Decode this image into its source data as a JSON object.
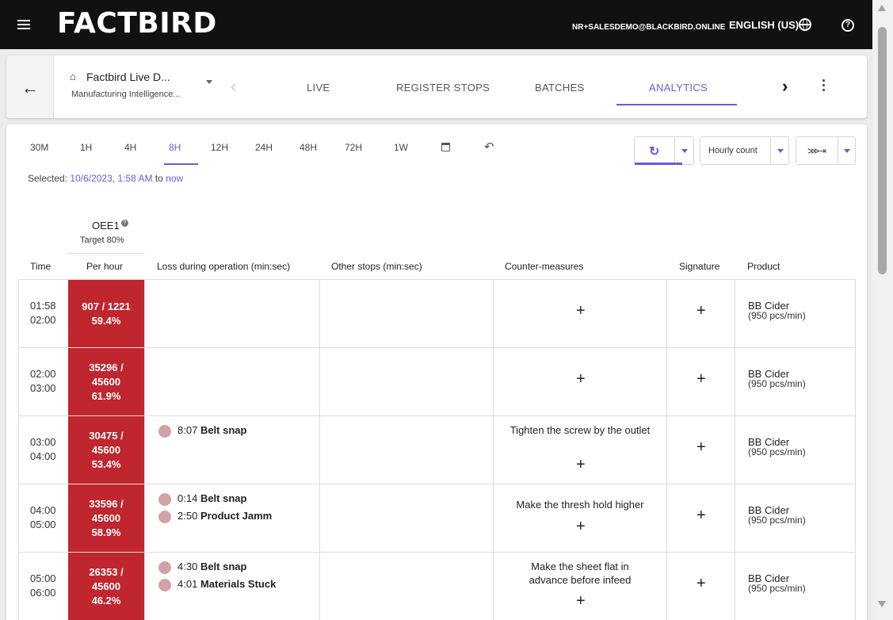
{
  "header": {
    "logo": "FACTBIRD",
    "email": "NR+SALESDEMO@BLACKBIRD.ONLINE",
    "language": "ENGLISH (US)",
    "help_icon": "?"
  },
  "device": {
    "name": "Factbird Live D...",
    "subtitle": "Manufacturing Intelligence..."
  },
  "tabs": [
    {
      "label": "LIVE"
    },
    {
      "label": "REGISTER STOPS"
    },
    {
      "label": "BATCHES"
    },
    {
      "label": "ANALYTICS"
    }
  ],
  "ranges": [
    "30M",
    "1H",
    "4H",
    "8H",
    "12H",
    "24H",
    "48H",
    "72H",
    "1W"
  ],
  "selected": {
    "prefix": "Selected:",
    "from": "10/6/2023, 1:58 AM",
    "to_word": "to",
    "to": "now"
  },
  "controls": {
    "count_label": "Hourly count",
    "layout_icon": "⋙⇥"
  },
  "table": {
    "oee_title": "OEE1",
    "oee_target": "Target 80%",
    "headers": {
      "time": "Time",
      "per_hour": "Per hour",
      "loss": "Loss during operation (min:sec)",
      "other": "Other stops (min:sec)",
      "counter": "Counter-measures",
      "signature": "Signature",
      "product": "Product"
    },
    "rows": [
      {
        "start": "01:58",
        "end": "02:00",
        "count": "907 / 1221",
        "pct": "59.4%",
        "losses": [],
        "counter": "",
        "product": "BB Cider",
        "rate": "(950 pcs/min)"
      },
      {
        "start": "02:00",
        "end": "03:00",
        "count_a": "35296 /",
        "count_b": "45600",
        "pct": "61.9%",
        "losses": [],
        "counter": "",
        "product": "BB Cider",
        "rate": "(950 pcs/min)"
      },
      {
        "start": "03:00",
        "end": "04:00",
        "count_a": "30475 /",
        "count_b": "45600",
        "pct": "53.4%",
        "losses": [
          {
            "time": "8:07",
            "reason": "Belt snap"
          }
        ],
        "counter": "Tighten the screw by the outlet",
        "product": "BB Cider",
        "rate": "(950 pcs/min)"
      },
      {
        "start": "04:00",
        "end": "05:00",
        "count_a": "33596 /",
        "count_b": "45600",
        "pct": "58.9%",
        "losses": [
          {
            "time": "0:14",
            "reason": "Belt snap"
          },
          {
            "time": "2:50",
            "reason": "Product Jamm"
          }
        ],
        "counter": "Make the thresh hold higher",
        "product": "BB Cider",
        "rate": "(950 pcs/min)"
      },
      {
        "start": "05:00",
        "end": "06:00",
        "count_a": "26353 /",
        "count_b": "45600",
        "pct": "46.2%",
        "losses": [
          {
            "time": "4:30",
            "reason": "Belt snap"
          },
          {
            "time": "4:01",
            "reason": "Materials Stuck"
          }
        ],
        "counter": "Make the sheet flat in advance before infeed",
        "product": "BB Cider",
        "rate": "(950 pcs/min)"
      }
    ]
  },
  "colors": {
    "accent": "#6a5ae0",
    "oee_bad": "#c0262e",
    "loss_dot": "#d3a2a6"
  }
}
